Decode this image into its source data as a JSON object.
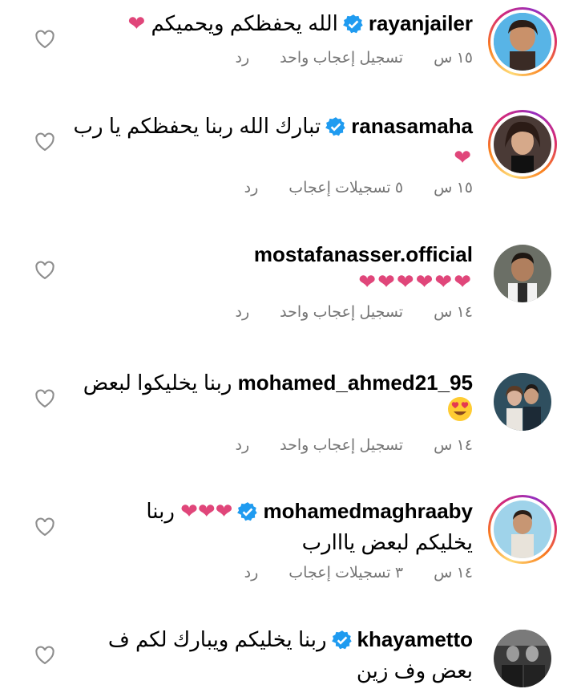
{
  "comments": [
    {
      "username": "rayanjailer",
      "verified": true,
      "story_ring": true,
      "text": "الله يحفظكم ويحميكم",
      "text2": "",
      "hearts": "❤",
      "time": "١٥ س",
      "likes": "تسجيل إعجاب واحد",
      "reply": "رد"
    },
    {
      "username": "ranasamaha",
      "verified": true,
      "story_ring": true,
      "text": "تبارك الله ربنا يحفظكم يا رب",
      "text2": "",
      "hearts": "❤",
      "time": "١٥ س",
      "likes": "٥ تسجيلات إعجاب",
      "reply": "رد"
    },
    {
      "username": "mostafanasser.official",
      "verified": false,
      "story_ring": false,
      "text": "",
      "text2": "",
      "hearts": "❤❤❤❤❤❤",
      "time": "١٤ س",
      "likes": "تسجيل إعجاب واحد",
      "reply": "رد"
    },
    {
      "username": "mohamed_ahmed21_95",
      "verified": false,
      "story_ring": false,
      "text": "ربنا يخليكوا لبعض",
      "text2": "",
      "hearts": "",
      "time": "١٤ س",
      "likes": "تسجيل إعجاب واحد",
      "reply": "رد"
    },
    {
      "username": "mohamedmaghraaby",
      "verified": true,
      "story_ring": true,
      "text": "ربنا",
      "text2": "يخليكم لبعض يااارب",
      "hearts": "❤❤❤",
      "time": "١٤ س",
      "likes": "٣ تسجيلات إعجاب",
      "reply": "رد"
    },
    {
      "username": "khayametto",
      "verified": true,
      "story_ring": false,
      "text": "ربنا يخليكم ويبارك لكم ف",
      "text2": "بعض وف زين",
      "hearts": "",
      "time": "",
      "likes": "",
      "reply": ""
    }
  ],
  "colors": {
    "heart": "#e0467a",
    "verified": "#1f9bf0",
    "meta": "#757575"
  },
  "icons": {
    "like": "heart-outline-icon",
    "verified": "verified-badge-icon",
    "emoji": "heart-eyes-emoji-icon"
  }
}
